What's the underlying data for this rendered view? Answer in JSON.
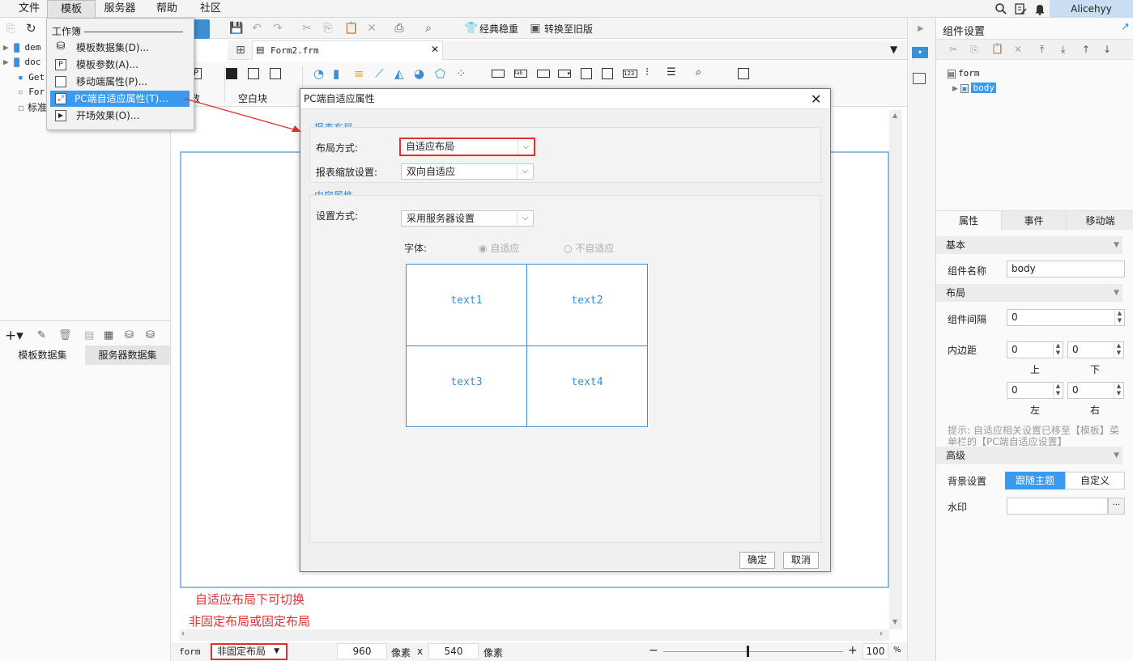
{
  "menu": {
    "file": "文件",
    "template": "模板",
    "server": "服务器",
    "help": "帮助",
    "community": "社区"
  },
  "user": "Alicehyy",
  "dropdown": {
    "header": "工作簿",
    "items": [
      {
        "label": "模板数据集(D)...",
        "icon": "database-icon"
      },
      {
        "label": "模板参数(A)...",
        "icon": "parameter-icon"
      },
      {
        "label": "移动端属性(P)...",
        "icon": "mobile-icon"
      },
      {
        "label": "PC端自适应属性(T)...",
        "icon": "resize-icon"
      },
      {
        "label": "开场效果(O)...",
        "icon": "play-icon"
      }
    ]
  },
  "left_tree": [
    "dem",
    "doc",
    "Get",
    "For",
    "标准"
  ],
  "left_tabs": {
    "template": "模板数据集",
    "server": "服务器数据集"
  },
  "toolbar": {
    "classic": "经典稳重",
    "convert": "转换至旧版",
    "group_param": "数",
    "group_blank": "空白块"
  },
  "tab": {
    "filename": "Form2.frm"
  },
  "dialog": {
    "title": "PC端自适应属性",
    "report_layout": "报表布局",
    "layout_mode_label": "布局方式:",
    "layout_mode_value": "自适应布局",
    "zoom_label": "报表缩放设置:",
    "zoom_value": "双向自适应",
    "content_props": "内容属性",
    "setting_label": "设置方式:",
    "setting_value": "采用服务器设置",
    "font_label": "字体:",
    "radio_adaptive": "自适应",
    "radio_not_adaptive": "不自适应",
    "cells": [
      "text1",
      "text2",
      "text3",
      "text4"
    ],
    "ok": "确定",
    "cancel": "取消"
  },
  "annotation": {
    "line1": "自适应布局下可切换",
    "line2": "非固定布局或固定布局"
  },
  "statusbar": {
    "form": "form",
    "layout": "非固定布局",
    "width": "960",
    "px1": "像素",
    "x": "x",
    "height": "540",
    "px2": "像素",
    "zoom": "100",
    "percent": "%"
  },
  "rightpanel": {
    "title": "组件设置",
    "tree_form": "form",
    "tree_body": "body",
    "tabs": [
      "属性",
      "事件",
      "移动端"
    ],
    "basic": "基本",
    "name_label": "组件名称",
    "name_value": "body",
    "layout": "布局",
    "gap_label": "组件间隔",
    "gap_value": "0",
    "padding_label": "内边距",
    "pad_top": "0",
    "pad_bottom": "0",
    "pad_left": "0",
    "pad_right": "0",
    "top": "上",
    "bottom": "下",
    "left": "左",
    "right": "右",
    "hint": "提示: 自适应相关设置已移至【模板】菜单栏的【PC端自适应设置】",
    "advanced": "高级",
    "bg_label": "背景设置",
    "bg_follow": "跟随主题",
    "bg_custom": "自定义",
    "watermark_label": "水印",
    "ellipsis": "···"
  }
}
